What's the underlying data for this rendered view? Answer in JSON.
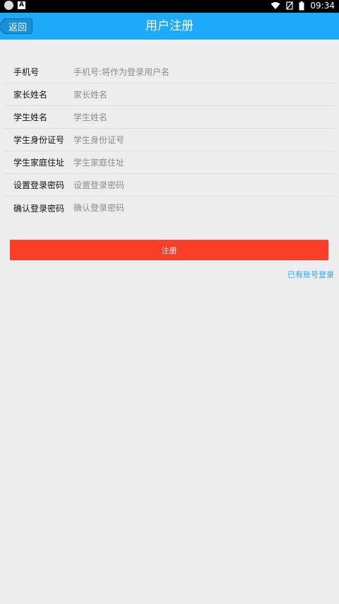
{
  "status_bar": {
    "time": "09:34",
    "icons": [
      "app-notification-icon",
      "a-notification-icon",
      "wifi-icon",
      "no-sim-icon",
      "battery-icon"
    ]
  },
  "header": {
    "back_label": "返回",
    "title": "用户注册",
    "accent_color": "#1eaafa"
  },
  "form": {
    "fields": [
      {
        "label": "手机号",
        "placeholder": "手机号:将作为登录用户名",
        "value": ""
      },
      {
        "label": "家长姓名",
        "placeholder": "家长姓名",
        "value": ""
      },
      {
        "label": "学生姓名",
        "placeholder": "学生姓名",
        "value": ""
      },
      {
        "label": "学生身份证号",
        "placeholder": "学生身份证号",
        "value": ""
      },
      {
        "label": "学生家庭住址",
        "placeholder": "学生家庭住址",
        "value": ""
      },
      {
        "label": "设置登录密码",
        "placeholder": "设置登录密码",
        "value": ""
      },
      {
        "label": "确认登录密码",
        "placeholder": "确认登录密码",
        "value": ""
      }
    ],
    "submit_label": "注册",
    "submit_color": "#fa3e28",
    "login_link": "已有账号登录"
  }
}
